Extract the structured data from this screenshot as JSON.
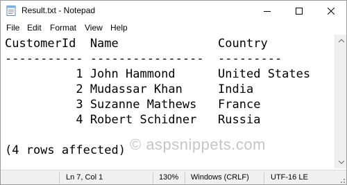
{
  "window": {
    "title": "Result.txt - Notepad",
    "icon": "notepad-icon",
    "controls": {
      "minimize": "minimize-icon",
      "maximize": "maximize-icon",
      "close": "close-icon"
    }
  },
  "menu": {
    "items": [
      "File",
      "Edit",
      "Format",
      "View",
      "Help"
    ]
  },
  "editor": {
    "lines": [
      "CustomerId  Name              Country",
      "----------- ----------------  ---------",
      "          1 John Hammond      United States",
      "          2 Mudassar Khan     India",
      "          3 Suzanne Mathews   France",
      "          4 Robert Schidner   Russia",
      "",
      "(4 rows affected)"
    ],
    "watermark": "© aspsnippets.com"
  },
  "status": {
    "position": "Ln 7, Col 1",
    "zoom": "130%",
    "line_endings": "Windows (CRLF)",
    "encoding": "UTF-16 LE"
  }
}
